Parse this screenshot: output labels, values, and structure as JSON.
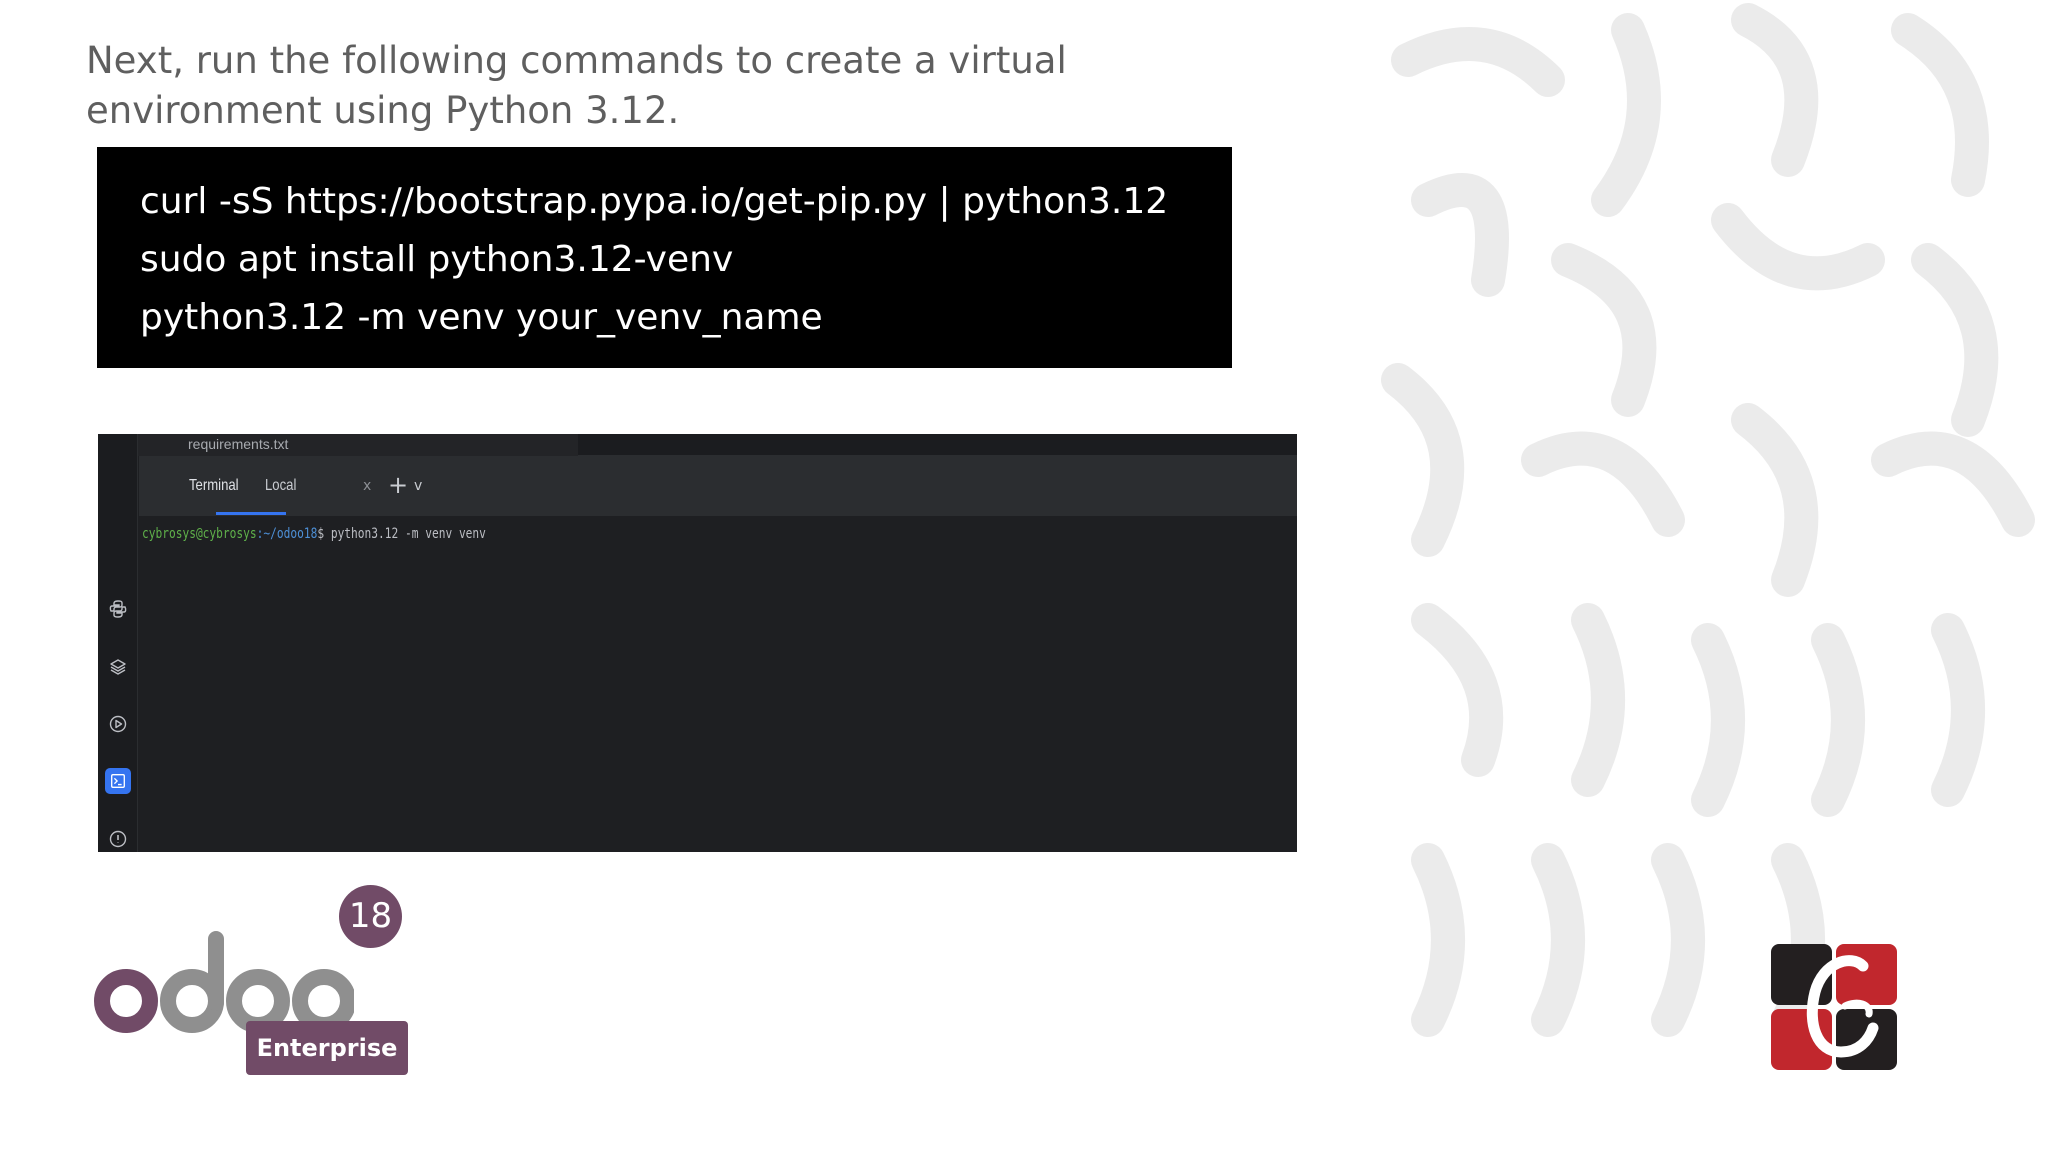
{
  "slide": {
    "intro_text": "Next, run the following commands to create a virtual environment using Python 3.12.",
    "commands": [
      "curl -sS https://bootstrap.pypa.io/get-pip.py | python3.12",
      "sudo apt install python3.12-venv",
      "python3.12 -m venv your_venv_name"
    ]
  },
  "ide": {
    "open_file": "requirements.txt",
    "tabs": [
      "Terminal",
      "Local"
    ],
    "tab_close": "x",
    "add_tab": "+",
    "dropdown": "v",
    "prompt_user": "cybrosys@cybrosys",
    "prompt_path": ":~/odoo18",
    "prompt_symbol": "$",
    "command": "python3.12 -m venv venv",
    "sidebar_icons": [
      "python-icon",
      "layers-icon",
      "run-icon",
      "terminal-icon",
      "problems-icon"
    ]
  },
  "branding": {
    "product": "odoo",
    "version": "18",
    "edition": "Enterprise",
    "colors": {
      "odoo_purple": "#714b67",
      "odoo_gray": "#8f8f8f",
      "cyb_red": "#c1272d",
      "cyb_dark": "#231f20"
    }
  }
}
